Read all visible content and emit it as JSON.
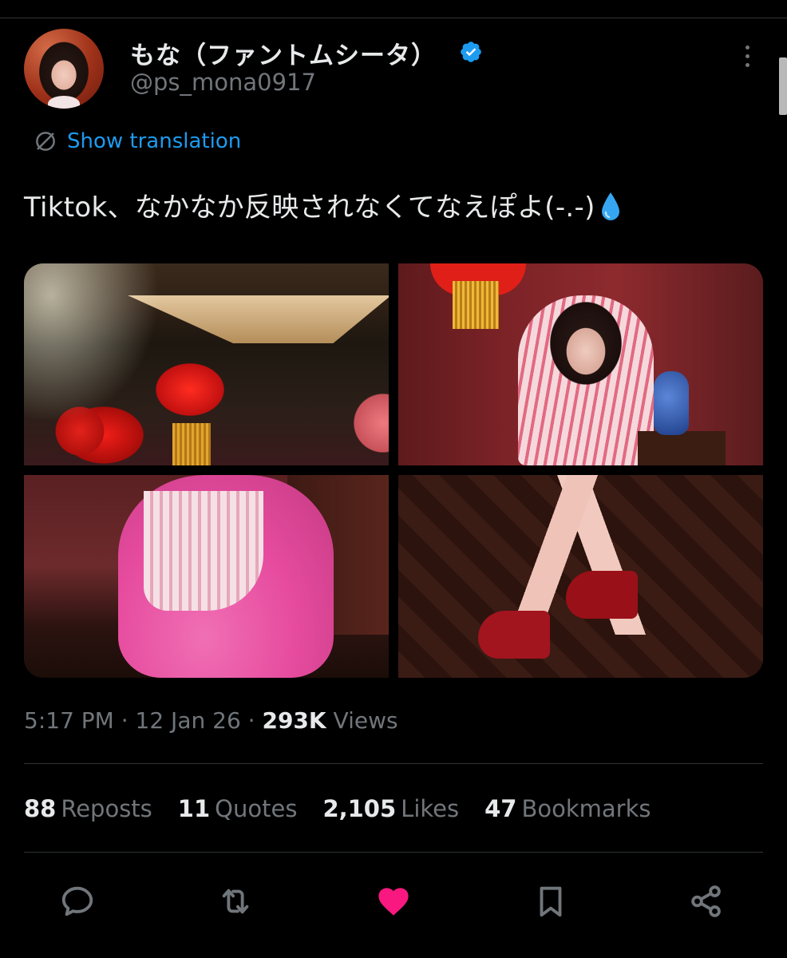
{
  "author": {
    "display_name": "もな（ファントムシータ）",
    "handle": "@ps_mona0917",
    "verified": true
  },
  "translate_label": "Show translation",
  "tweet_text": "Tiktok、なかなか反映されなくてなえぽよ(-.-)",
  "tweet_emoji": "droplet-emoji",
  "media": {
    "photo_count": 4
  },
  "meta": {
    "time": "5:17 PM",
    "sep1": " · ",
    "date": "12 Jan 26",
    "sep2": " · ",
    "views_count": "293K",
    "views_label": " Views"
  },
  "stats": {
    "reposts": {
      "count": "88",
      "label": "Reposts"
    },
    "quotes": {
      "count": "11",
      "label": "Quotes"
    },
    "likes": {
      "count": "2,105",
      "label": "Likes"
    },
    "bookmarks": {
      "count": "47",
      "label": "Bookmarks"
    }
  },
  "actions": [
    "reply-icon",
    "repost-icon",
    "like-icon",
    "bookmark-icon",
    "share-icon"
  ],
  "colors": {
    "background": "#000000",
    "text": "#e7e9ea",
    "secondary": "#71767b",
    "link": "#1d9bf0",
    "like": "#f91880",
    "divider": "#2f3336"
  }
}
